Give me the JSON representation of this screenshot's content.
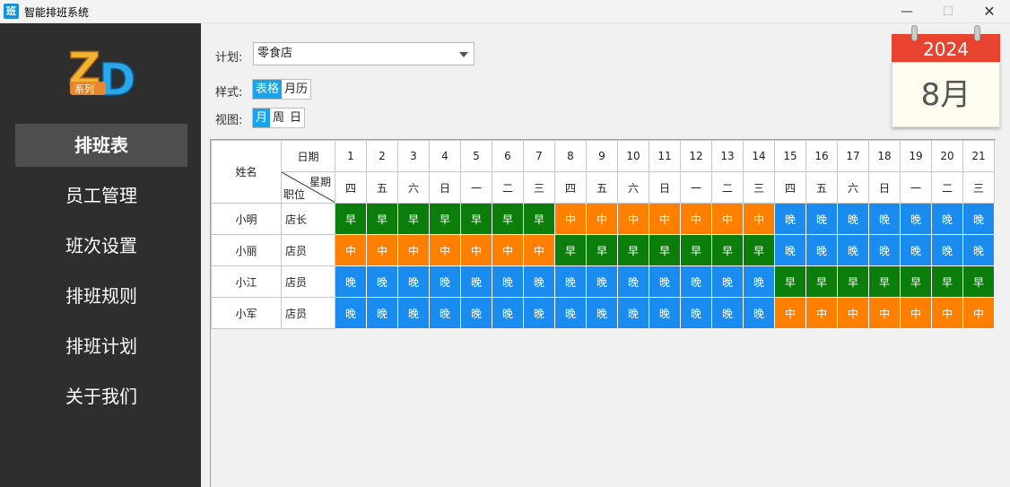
{
  "window": {
    "app_icon_text": "班",
    "title": "智能排班系统",
    "minimize": "—",
    "maximize": "☐",
    "close": "✕"
  },
  "sidebar": {
    "logo": {
      "letters": "ZD",
      "tag": "系列"
    },
    "items": [
      {
        "label": "排班表",
        "active": true
      },
      {
        "label": "员工管理"
      },
      {
        "label": "班次设置"
      },
      {
        "label": "排班规则"
      },
      {
        "label": "排班计划"
      },
      {
        "label": "关于我们"
      }
    ]
  },
  "controls": {
    "plan_label": "计划:",
    "plan_value": "零食店",
    "style_label": "样式:",
    "style_options": [
      "表格",
      "月历"
    ],
    "style_selected": "表格",
    "view_label": "视图:",
    "view_options": [
      "月",
      "周",
      "日"
    ],
    "view_selected": "月"
  },
  "calendar_badge": {
    "year": "2024",
    "month": "8月"
  },
  "table": {
    "name_header": "姓名",
    "date_header": "日期",
    "week_header": "星期",
    "position_header": "职位",
    "days": [
      "1",
      "2",
      "3",
      "4",
      "5",
      "6",
      "7",
      "8",
      "9",
      "10",
      "11",
      "12",
      "13",
      "14",
      "15",
      "16",
      "17",
      "18",
      "19",
      "20",
      "21"
    ],
    "weekdays": [
      "四",
      "五",
      "六",
      "日",
      "一",
      "二",
      "三",
      "四",
      "五",
      "六",
      "日",
      "一",
      "二",
      "三",
      "四",
      "五",
      "六",
      "日",
      "一",
      "二",
      "三"
    ],
    "shift_colors": {
      "早": "#0a7d0a",
      "中": "#ff8000",
      "晚": "#1a8cf0"
    },
    "rows": [
      {
        "name": "小明",
        "position": "店长",
        "shifts": [
          "早",
          "早",
          "早",
          "早",
          "早",
          "早",
          "早",
          "中",
          "中",
          "中",
          "中",
          "中",
          "中",
          "中",
          "晚",
          "晚",
          "晚",
          "晚",
          "晚",
          "晚",
          "晚"
        ]
      },
      {
        "name": "小丽",
        "position": "店员",
        "shifts": [
          "中",
          "中",
          "中",
          "中",
          "中",
          "中",
          "中",
          "早",
          "早",
          "早",
          "早",
          "早",
          "早",
          "早",
          "晚",
          "晚",
          "晚",
          "晚",
          "晚",
          "晚",
          "晚"
        ]
      },
      {
        "name": "小江",
        "position": "店员",
        "shifts": [
          "晚",
          "晚",
          "晚",
          "晚",
          "晚",
          "晚",
          "晚",
          "晚",
          "晚",
          "晚",
          "晚",
          "晚",
          "晚",
          "晚",
          "早",
          "早",
          "早",
          "早",
          "早",
          "早",
          "早"
        ]
      },
      {
        "name": "小军",
        "position": "店员",
        "shifts": [
          "晚",
          "晚",
          "晚",
          "晚",
          "晚",
          "晚",
          "晚",
          "晚",
          "晚",
          "晚",
          "晚",
          "晚",
          "晚",
          "晚",
          "中",
          "中",
          "中",
          "中",
          "中",
          "中",
          "中"
        ]
      }
    ]
  }
}
